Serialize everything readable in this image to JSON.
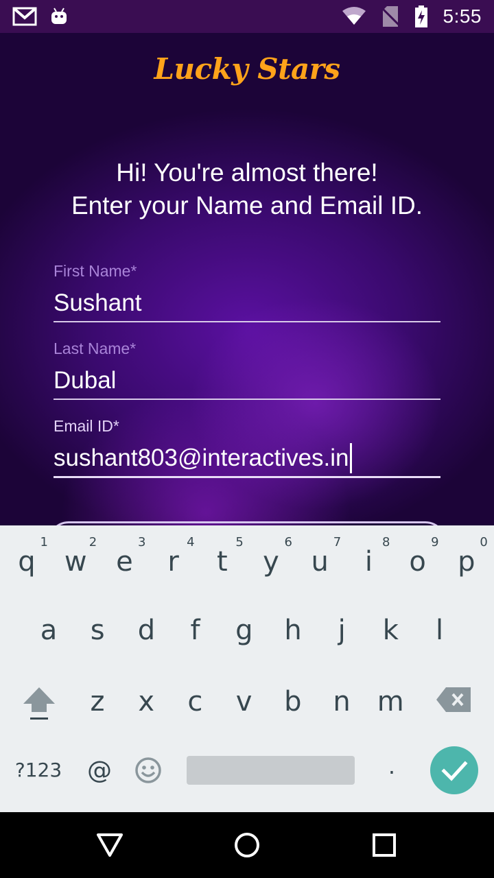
{
  "status_bar": {
    "time": "5:55",
    "left_icons": [
      "gmail-icon",
      "android-icon"
    ],
    "right_icons": [
      "wifi-icon",
      "no-sim-icon",
      "battery-charging-icon"
    ]
  },
  "app": {
    "title": "Lucky Stars",
    "intro_line1": "Hi! You're almost there!",
    "intro_line2": "Enter your Name and Email ID.",
    "colors": {
      "title": "#ffa31a",
      "label": "#a984d8",
      "background": "#3a0a6e"
    },
    "fields": [
      {
        "label": "First Name*",
        "value": "Sushant"
      },
      {
        "label": "Last Name*",
        "value": "Dubal"
      },
      {
        "label": "Email ID*",
        "value": "sushant803@interactives.in"
      }
    ]
  },
  "keyboard": {
    "row1": [
      "q",
      "w",
      "e",
      "r",
      "t",
      "y",
      "u",
      "i",
      "o",
      "p"
    ],
    "row1_hints": [
      "1",
      "2",
      "3",
      "4",
      "5",
      "6",
      "7",
      "8",
      "9",
      "0"
    ],
    "row2": [
      "a",
      "s",
      "d",
      "f",
      "g",
      "h",
      "j",
      "k",
      "l"
    ],
    "row3": [
      "z",
      "x",
      "c",
      "v",
      "b",
      "n",
      "m"
    ],
    "symbols_key": "?123",
    "at_key": "@",
    "period_key": ".",
    "accent_color": "#4db6ac"
  },
  "nav_bar": {
    "icons": [
      "back-icon",
      "home-icon",
      "recents-icon"
    ]
  }
}
